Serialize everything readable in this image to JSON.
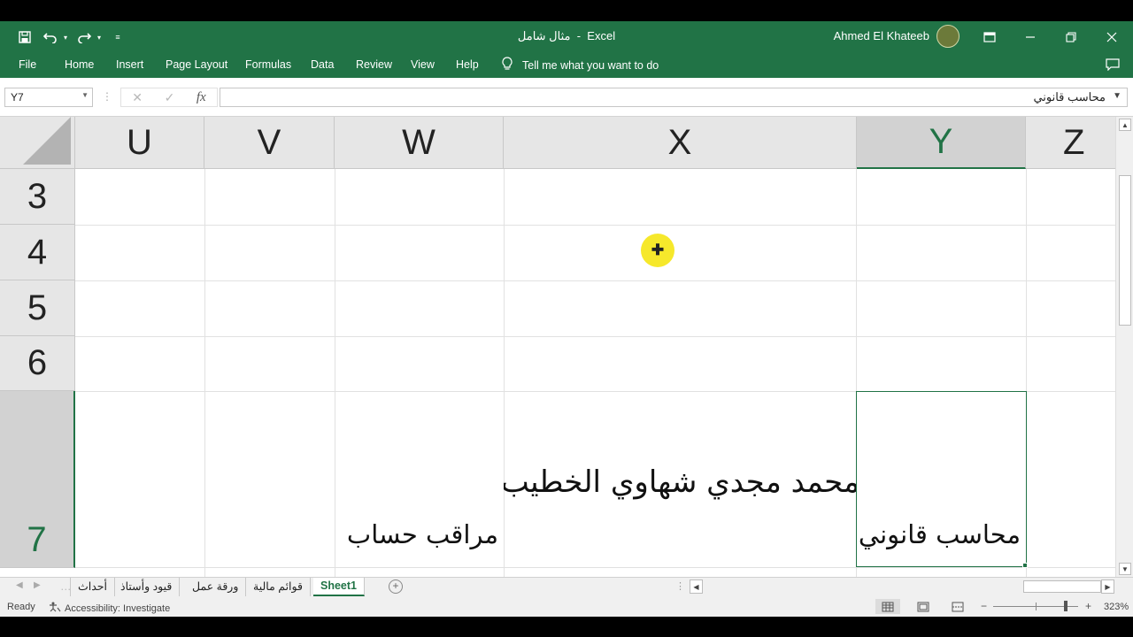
{
  "window": {
    "file_name": "مثال شامل",
    "app_name": "Excel",
    "title_separator": "-",
    "user_name": "Ahmed El Khateeb"
  },
  "qat": {
    "save_icon": "save-icon",
    "undo_icon": "undo-icon",
    "redo_icon": "redo-icon",
    "customize_icon": "customize-qat-icon"
  },
  "ribbon": {
    "tabs": [
      "File",
      "Home",
      "Insert",
      "Page Layout",
      "Formulas",
      "Data",
      "Review",
      "View",
      "Help"
    ],
    "tell_me": "Tell me what you want to do"
  },
  "formula_bar": {
    "name_box": "Y7",
    "content": "محاسب قانوني"
  },
  "grid": {
    "columns": [
      "U",
      "V",
      "W",
      "X",
      "Y",
      "Z"
    ],
    "rows": [
      "3",
      "4",
      "5",
      "6",
      "7"
    ],
    "selected_column": "Y",
    "selected_row": "7",
    "cells": {
      "x7": "محمد مجدي شهاوي الخطيب",
      "w7": "مراقب حساب",
      "y7": "محاسب قانوني"
    }
  },
  "sheets": {
    "tabs": [
      "أحداث",
      "قيود وأستاذ",
      "ورقة عمل",
      "قوائم مالية",
      "Sheet1"
    ],
    "active": "Sheet1"
  },
  "status": {
    "ready": "Ready",
    "accessibility": "Accessibility: Investigate",
    "zoom_minus": "−",
    "zoom_plus": "+",
    "zoom": "323%",
    "zoom_fraction": 0.85
  },
  "colors": {
    "brand": "#217346",
    "cursor_highlight": "#f5e614"
  }
}
